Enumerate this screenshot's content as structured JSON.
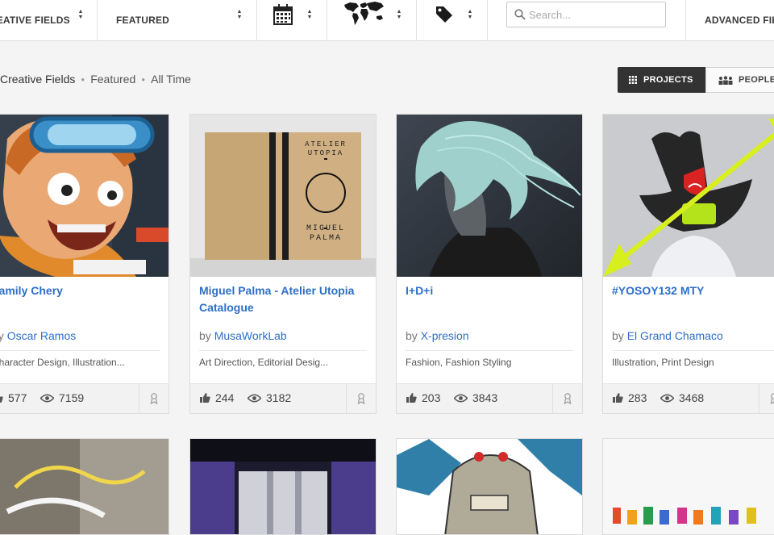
{
  "filters": {
    "creative_fields": "CREATIVE FIELDS",
    "featured": "FEATURED",
    "calendar_icon": "calendar-icon",
    "map_icon": "world-map-icon",
    "tag_icon": "tag-icon",
    "search_placeholder": "Search...",
    "advanced": "ADVANCED FILTERS"
  },
  "breadcrumb": {
    "items": [
      "Creative Fields",
      "Featured",
      "All Time"
    ]
  },
  "view_toggle": {
    "projects": "PROJECTS",
    "people": "PEOPLE",
    "active": "projects"
  },
  "projects": [
    {
      "title": "Family Chery",
      "by": "by",
      "author": "Oscar Ramos",
      "fields": "Character Design, Illustration...",
      "appreciations": "577",
      "views": "7159"
    },
    {
      "title": "Miguel Palma - Atelier Utopia Catalogue",
      "by": "by",
      "author": "MusaWorkLab",
      "fields": "Art Direction, Editorial Desig...",
      "appreciations": "244",
      "views": "3182",
      "cover_text_top": "ATELIER UTOPIA",
      "cover_text_bottom": "MIGUEL PALMA"
    },
    {
      "title": "I+D+i",
      "by": "by",
      "author": "X-presion",
      "fields": "Fashion, Fashion Styling",
      "appreciations": "203",
      "views": "3843"
    },
    {
      "title": "#YOSOY132 MTY",
      "by": "by",
      "author": "El Grand Chamaco",
      "fields": "Illustration, Print Design",
      "appreciations": "283",
      "views": "3468"
    }
  ],
  "colors": {
    "link": "#2d6fc7",
    "toggle_active": "#333333"
  }
}
